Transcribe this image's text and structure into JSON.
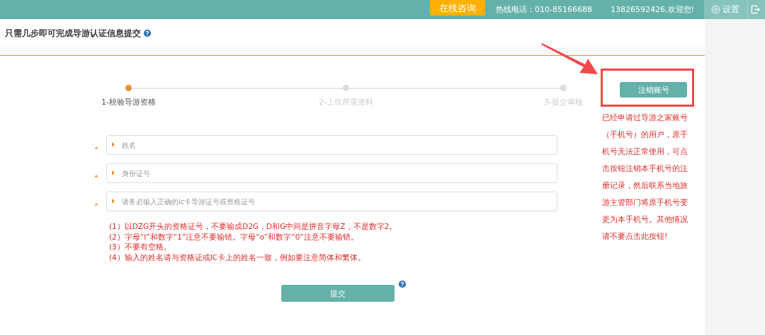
{
  "header": {
    "consult_button": "在线咨询",
    "hotline": "热线电话：010-85166688",
    "welcome": "13826592426,欢迎您!",
    "settings": "设置"
  },
  "page_title": "只需几步即可完成导游认证信息提交",
  "steps": [
    {
      "label": "1-校验导游资格",
      "selected": true
    },
    {
      "label": "2-上传所需资料",
      "selected": false
    },
    {
      "label": "3-提交审核",
      "selected": false
    }
  ],
  "fields": [
    {
      "placeholder": "姓名",
      "required": true
    },
    {
      "placeholder": "身份证号",
      "required": true
    },
    {
      "placeholder": "请务必输入正确的ic卡导游证号或资格证号",
      "required": true
    }
  ],
  "notes": [
    "(1）以DZG开头的资格证号，不要输成D2G，D和G中间是拼音字母Z，不是数字2。",
    "(2）字母“I”和数字“1”注意不要输错。字母“o”和数字“0”注意不要输错。",
    "(3）不要有空格。",
    "(4）输入的姓名请与资格证或IC卡上的姓名一致，例如要注意简体和繁体。"
  ],
  "submit": "提交",
  "side": {
    "cancel_button": "注销账号",
    "note": "已经申请过导游之家账号（手机号）的用户，原手机号无法正常使用，可点击按钮注销本手机号的注册记录，然后联系当地旅游主管部门将原手机号变更为本手机号。其他情况请不要点击此按钮!"
  }
}
